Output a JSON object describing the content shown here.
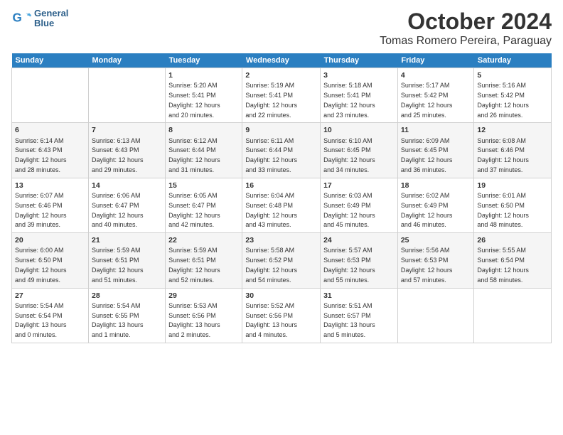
{
  "logo": {
    "line1": "General",
    "line2": "Blue"
  },
  "title": "October 2024",
  "subtitle": "Tomas Romero Pereira, Paraguay",
  "days_header": [
    "Sunday",
    "Monday",
    "Tuesday",
    "Wednesday",
    "Thursday",
    "Friday",
    "Saturday"
  ],
  "weeks": [
    [
      {
        "day": "",
        "info": ""
      },
      {
        "day": "",
        "info": ""
      },
      {
        "day": "1",
        "info": "Sunrise: 5:20 AM\nSunset: 5:41 PM\nDaylight: 12 hours\nand 20 minutes."
      },
      {
        "day": "2",
        "info": "Sunrise: 5:19 AM\nSunset: 5:41 PM\nDaylight: 12 hours\nand 22 minutes."
      },
      {
        "day": "3",
        "info": "Sunrise: 5:18 AM\nSunset: 5:41 PM\nDaylight: 12 hours\nand 23 minutes."
      },
      {
        "day": "4",
        "info": "Sunrise: 5:17 AM\nSunset: 5:42 PM\nDaylight: 12 hours\nand 25 minutes."
      },
      {
        "day": "5",
        "info": "Sunrise: 5:16 AM\nSunset: 5:42 PM\nDaylight: 12 hours\nand 26 minutes."
      }
    ],
    [
      {
        "day": "6",
        "info": "Sunrise: 6:14 AM\nSunset: 6:43 PM\nDaylight: 12 hours\nand 28 minutes."
      },
      {
        "day": "7",
        "info": "Sunrise: 6:13 AM\nSunset: 6:43 PM\nDaylight: 12 hours\nand 29 minutes."
      },
      {
        "day": "8",
        "info": "Sunrise: 6:12 AM\nSunset: 6:44 PM\nDaylight: 12 hours\nand 31 minutes."
      },
      {
        "day": "9",
        "info": "Sunrise: 6:11 AM\nSunset: 6:44 PM\nDaylight: 12 hours\nand 33 minutes."
      },
      {
        "day": "10",
        "info": "Sunrise: 6:10 AM\nSunset: 6:45 PM\nDaylight: 12 hours\nand 34 minutes."
      },
      {
        "day": "11",
        "info": "Sunrise: 6:09 AM\nSunset: 6:45 PM\nDaylight: 12 hours\nand 36 minutes."
      },
      {
        "day": "12",
        "info": "Sunrise: 6:08 AM\nSunset: 6:46 PM\nDaylight: 12 hours\nand 37 minutes."
      }
    ],
    [
      {
        "day": "13",
        "info": "Sunrise: 6:07 AM\nSunset: 6:46 PM\nDaylight: 12 hours\nand 39 minutes."
      },
      {
        "day": "14",
        "info": "Sunrise: 6:06 AM\nSunset: 6:47 PM\nDaylight: 12 hours\nand 40 minutes."
      },
      {
        "day": "15",
        "info": "Sunrise: 6:05 AM\nSunset: 6:47 PM\nDaylight: 12 hours\nand 42 minutes."
      },
      {
        "day": "16",
        "info": "Sunrise: 6:04 AM\nSunset: 6:48 PM\nDaylight: 12 hours\nand 43 minutes."
      },
      {
        "day": "17",
        "info": "Sunrise: 6:03 AM\nSunset: 6:49 PM\nDaylight: 12 hours\nand 45 minutes."
      },
      {
        "day": "18",
        "info": "Sunrise: 6:02 AM\nSunset: 6:49 PM\nDaylight: 12 hours\nand 46 minutes."
      },
      {
        "day": "19",
        "info": "Sunrise: 6:01 AM\nSunset: 6:50 PM\nDaylight: 12 hours\nand 48 minutes."
      }
    ],
    [
      {
        "day": "20",
        "info": "Sunrise: 6:00 AM\nSunset: 6:50 PM\nDaylight: 12 hours\nand 49 minutes."
      },
      {
        "day": "21",
        "info": "Sunrise: 5:59 AM\nSunset: 6:51 PM\nDaylight: 12 hours\nand 51 minutes."
      },
      {
        "day": "22",
        "info": "Sunrise: 5:59 AM\nSunset: 6:51 PM\nDaylight: 12 hours\nand 52 minutes."
      },
      {
        "day": "23",
        "info": "Sunrise: 5:58 AM\nSunset: 6:52 PM\nDaylight: 12 hours\nand 54 minutes."
      },
      {
        "day": "24",
        "info": "Sunrise: 5:57 AM\nSunset: 6:53 PM\nDaylight: 12 hours\nand 55 minutes."
      },
      {
        "day": "25",
        "info": "Sunrise: 5:56 AM\nSunset: 6:53 PM\nDaylight: 12 hours\nand 57 minutes."
      },
      {
        "day": "26",
        "info": "Sunrise: 5:55 AM\nSunset: 6:54 PM\nDaylight: 12 hours\nand 58 minutes."
      }
    ],
    [
      {
        "day": "27",
        "info": "Sunrise: 5:54 AM\nSunset: 6:54 PM\nDaylight: 13 hours\nand 0 minutes."
      },
      {
        "day": "28",
        "info": "Sunrise: 5:54 AM\nSunset: 6:55 PM\nDaylight: 13 hours\nand 1 minute."
      },
      {
        "day": "29",
        "info": "Sunrise: 5:53 AM\nSunset: 6:56 PM\nDaylight: 13 hours\nand 2 minutes."
      },
      {
        "day": "30",
        "info": "Sunrise: 5:52 AM\nSunset: 6:56 PM\nDaylight: 13 hours\nand 4 minutes."
      },
      {
        "day": "31",
        "info": "Sunrise: 5:51 AM\nSunset: 6:57 PM\nDaylight: 13 hours\nand 5 minutes."
      },
      {
        "day": "",
        "info": ""
      },
      {
        "day": "",
        "info": ""
      }
    ]
  ]
}
